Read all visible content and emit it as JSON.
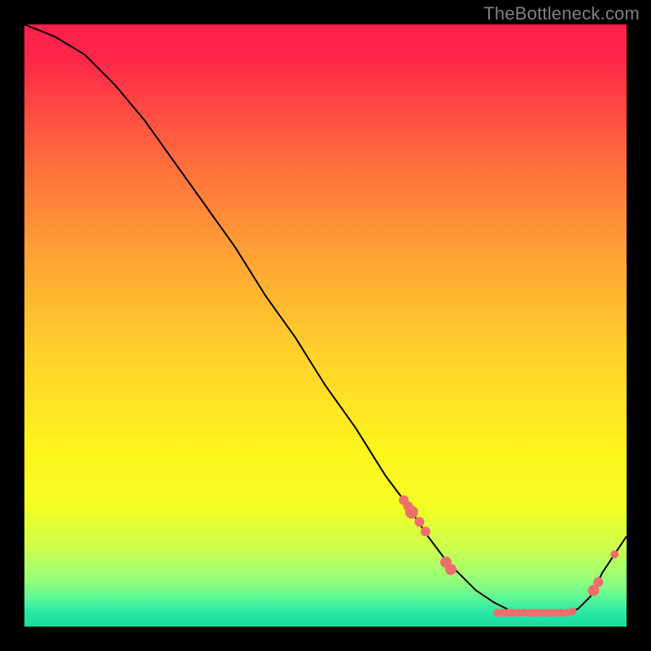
{
  "attribution": "TheBottleneck.com",
  "chart_data": {
    "type": "line",
    "title": "",
    "xlabel": "",
    "ylabel": "",
    "xlim": [
      0,
      100
    ],
    "ylim": [
      0,
      100
    ],
    "grid": false,
    "legend": false,
    "series": [
      {
        "name": "curve",
        "x": [
          0,
          5,
          10,
          15,
          20,
          25,
          30,
          35,
          40,
          45,
          50,
          55,
          60,
          63,
          67,
          70,
          73,
          75,
          78,
          80,
          82,
          84,
          85,
          88,
          90,
          92,
          94,
          96,
          100
        ],
        "y": [
          100,
          98,
          95,
          90,
          84,
          77,
          70,
          63,
          55,
          48,
          40,
          33,
          25,
          21,
          15,
          11,
          8,
          6,
          4,
          3,
          2,
          2,
          2,
          2,
          2,
          3,
          5,
          9,
          15
        ]
      }
    ],
    "markers": [
      {
        "x": 63.0,
        "y": 21.0,
        "r": 6
      },
      {
        "x": 63.7,
        "y": 20.0,
        "r": 6
      },
      {
        "x": 64.3,
        "y": 19.0,
        "r": 8
      },
      {
        "x": 65.6,
        "y": 17.4,
        "r": 6
      },
      {
        "x": 66.6,
        "y": 15.8,
        "r": 6
      },
      {
        "x": 70.0,
        "y": 10.7,
        "r": 7
      },
      {
        "x": 70.8,
        "y": 9.5,
        "r": 7
      },
      {
        "x": 78.5,
        "y": 2.3,
        "r": 5
      },
      {
        "x": 79.5,
        "y": 2.3,
        "r": 5
      },
      {
        "x": 80.3,
        "y": 2.3,
        "r": 5
      },
      {
        "x": 81.0,
        "y": 2.3,
        "r": 5
      },
      {
        "x": 82.0,
        "y": 2.3,
        "r": 5
      },
      {
        "x": 83.0,
        "y": 2.3,
        "r": 5
      },
      {
        "x": 84.0,
        "y": 2.3,
        "r": 5
      },
      {
        "x": 84.7,
        "y": 2.3,
        "r": 5
      },
      {
        "x": 85.5,
        "y": 2.3,
        "r": 5
      },
      {
        "x": 86.5,
        "y": 2.3,
        "r": 5
      },
      {
        "x": 87.3,
        "y": 2.3,
        "r": 5
      },
      {
        "x": 88.2,
        "y": 2.3,
        "r": 5
      },
      {
        "x": 89.0,
        "y": 2.3,
        "r": 5
      },
      {
        "x": 90.0,
        "y": 2.3,
        "r": 5
      },
      {
        "x": 91.0,
        "y": 2.5,
        "r": 5
      },
      {
        "x": 94.5,
        "y": 6.0,
        "r": 7
      },
      {
        "x": 95.3,
        "y": 7.4,
        "r": 6
      },
      {
        "x": 98.0,
        "y": 12.0,
        "r": 5
      }
    ],
    "gradient_stops": [
      {
        "offset": 0.0,
        "color": "#ff1f4b"
      },
      {
        "offset": 0.06,
        "color": "#ff2749"
      },
      {
        "offset": 0.22,
        "color": "#ff6a3d"
      },
      {
        "offset": 0.4,
        "color": "#ffa834"
      },
      {
        "offset": 0.55,
        "color": "#ffd22b"
      },
      {
        "offset": 0.7,
        "color": "#fff31d"
      },
      {
        "offset": 0.8,
        "color": "#f3ff25"
      },
      {
        "offset": 0.87,
        "color": "#ccff4e"
      },
      {
        "offset": 0.92,
        "color": "#99ff77"
      },
      {
        "offset": 0.955,
        "color": "#57f59b"
      },
      {
        "offset": 0.975,
        "color": "#2be9a3"
      },
      {
        "offset": 1.0,
        "color": "#17dca0"
      }
    ],
    "marker_color": "#ee6e6d",
    "line_color": "#000000"
  }
}
